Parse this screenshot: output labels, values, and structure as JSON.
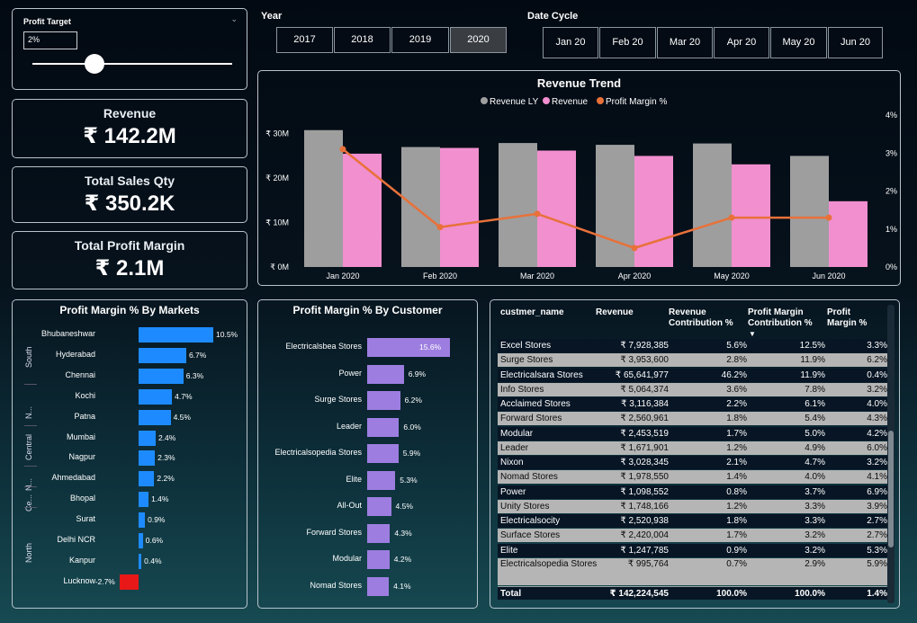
{
  "slicer": {
    "label": "Profit Target",
    "value": "2%",
    "slider_fraction": 0.31
  },
  "kpis": [
    {
      "title": "Revenue",
      "value": "₹ 142.2M"
    },
    {
      "title": "Total Sales Qty",
      "value": "₹ 350.2K"
    },
    {
      "title": "Total Profit Margin",
      "value": "₹ 2.1M"
    }
  ],
  "year": {
    "label": "Year",
    "options": [
      "2017",
      "2018",
      "2019",
      "2020"
    ],
    "selected": "2020"
  },
  "date_cycle": {
    "label": "Date Cycle",
    "options": [
      "Jan 20",
      "Feb 20",
      "Mar 20",
      "Apr 20",
      "May 20",
      "Jun 20"
    ]
  },
  "colors": {
    "revenue_ly": "#9e9e9e",
    "revenue": "#f28fcf",
    "margin": "#e8713a",
    "positive": "#1d8bff",
    "negative": "#e81818",
    "customer": "#9d7ee0"
  },
  "chart_data": [
    {
      "type": "bar",
      "title": "Revenue Trend",
      "categories": [
        "Jan 2020",
        "Feb 2020",
        "Mar 2020",
        "Apr 2020",
        "May 2020",
        "Jun 2020"
      ],
      "series": [
        {
          "name": "Revenue LY",
          "values": [
            30.8,
            27.0,
            27.9,
            27.5,
            27.8,
            25.0
          ]
        },
        {
          "name": "Revenue",
          "values": [
            25.5,
            26.8,
            26.2,
            25.0,
            23.1,
            14.8
          ]
        },
        {
          "name": "Profit Margin %",
          "axis": "right",
          "values": [
            3.1,
            1.05,
            1.4,
            0.5,
            1.3,
            1.3
          ]
        }
      ],
      "y_ticks": [
        "₹ 0M",
        "₹ 10M",
        "₹ 20M",
        "₹ 30M"
      ],
      "ylim": [
        0,
        35
      ],
      "y2_ticks": [
        "0%",
        "1%",
        "2%",
        "3%",
        "4%"
      ],
      "y2lim": [
        0,
        4
      ],
      "legend": "top-center"
    },
    {
      "type": "bar",
      "title": "Profit Margin % By Markets",
      "categories": [
        "Bhubaneshwar",
        "Hyderabad",
        "Chennai",
        "Kochi",
        "Patna",
        "Mumbai",
        "Nagpur",
        "Ahmedabad",
        "Bhopal",
        "Surat",
        "Delhi NCR",
        "Kanpur",
        "Lucknow"
      ],
      "values": [
        10.5,
        6.7,
        6.3,
        4.7,
        4.5,
        2.4,
        2.3,
        2.2,
        1.4,
        0.9,
        0.6,
        0.4,
        -2.7
      ],
      "labels": [
        "10.5%",
        "6.7%",
        "6.3%",
        "4.7%",
        "4.5%",
        "2.4%",
        "2.3%",
        "2.2%",
        "1.4%",
        "0.9%",
        "0.6%",
        "0.4%",
        "-2.7%"
      ],
      "groups": [
        {
          "name": "South",
          "start": 0,
          "end": 2
        },
        {
          "name": "N...",
          "start": 3,
          "end": 4
        },
        {
          "name": "Central",
          "start": 5,
          "end": 6
        },
        {
          "name": "N...",
          "start": 7,
          "end": 7
        },
        {
          "name": "Ce...",
          "start": 8,
          "end": 8
        },
        {
          "name": "North",
          "start": 9,
          "end": 12
        }
      ]
    },
    {
      "type": "bar",
      "title": "Profit Margin % By Customer",
      "categories": [
        "Electricalsbea Stores",
        "Power",
        "Surge Stores",
        "Leader",
        "Electricalsopedia Stores",
        "Elite",
        "All-Out",
        "Forward Stores",
        "Modular",
        "Nomad Stores"
      ],
      "values": [
        15.6,
        6.9,
        6.2,
        6.0,
        5.9,
        5.3,
        4.5,
        4.3,
        4.2,
        4.1
      ],
      "labels": [
        "15.6%",
        "6.9%",
        "6.2%",
        "6.0%",
        "5.9%",
        "5.3%",
        "4.5%",
        "4.3%",
        "4.2%",
        "4.1%"
      ]
    },
    {
      "type": "table",
      "columns": [
        "custmer_name",
        "Revenue",
        "Revenue Contribution %",
        "Profit Margin Contribution %",
        "Profit Margin %"
      ],
      "sort_indicator": "▼",
      "rows": [
        [
          "Excel Stores",
          "₹ 7,928,385",
          "5.6%",
          "12.5%",
          "3.3%"
        ],
        [
          "Surge Stores",
          "₹ 3,953,600",
          "2.8%",
          "11.9%",
          "6.2%"
        ],
        [
          "Electricalsara Stores",
          "₹ 65,641,977",
          "46.2%",
          "11.9%",
          "0.4%"
        ],
        [
          "Info Stores",
          "₹ 5,064,374",
          "3.6%",
          "7.8%",
          "3.2%"
        ],
        [
          "Acclaimed Stores",
          "₹ 3,116,384",
          "2.2%",
          "6.1%",
          "4.0%"
        ],
        [
          "Forward Stores",
          "₹ 2,560,961",
          "1.8%",
          "5.4%",
          "4.3%"
        ],
        [
          "Modular",
          "₹ 2,453,519",
          "1.7%",
          "5.0%",
          "4.2%"
        ],
        [
          "Leader",
          "₹ 1,671,901",
          "1.2%",
          "4.9%",
          "6.0%"
        ],
        [
          "Nixon",
          "₹ 3,028,345",
          "2.1%",
          "4.7%",
          "3.2%"
        ],
        [
          "Nomad Stores",
          "₹ 1,978,550",
          "1.4%",
          "4.0%",
          "4.1%"
        ],
        [
          "Power",
          "₹ 1,098,552",
          "0.8%",
          "3.7%",
          "6.9%"
        ],
        [
          "Unity Stores",
          "₹ 1,748,166",
          "1.2%",
          "3.3%",
          "3.9%"
        ],
        [
          "Electricalsocity",
          "₹ 2,520,938",
          "1.8%",
          "3.3%",
          "2.7%"
        ],
        [
          "Surface Stores",
          "₹ 2,420,004",
          "1.7%",
          "3.2%",
          "2.7%"
        ],
        [
          "Elite",
          "₹ 1,247,785",
          "0.9%",
          "3.2%",
          "5.3%"
        ],
        [
          "Electricalsopedia Stores",
          "₹ 995,764",
          "0.7%",
          "2.9%",
          "5.9%"
        ]
      ],
      "total": [
        "Total",
        "₹ 142,224,545",
        "100.0%",
        "100.0%",
        "1.4%"
      ]
    }
  ]
}
